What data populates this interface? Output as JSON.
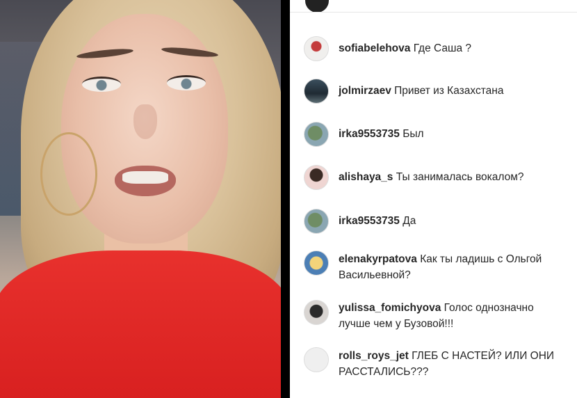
{
  "comments": [
    {
      "username": "sofiabelehova",
      "message": "Где Саша ?",
      "avatar": "profile-photo"
    },
    {
      "username": "jolmirzaev",
      "message": "Привет из Казахстана",
      "avatar": "profile-photo"
    },
    {
      "username": "irka9553735",
      "message": "Был",
      "avatar": "profile-photo"
    },
    {
      "username": "alishaya_s",
      "message": "Ты занималась вокалом?",
      "avatar": "profile-photo"
    },
    {
      "username": "irka9553735",
      "message": "Да",
      "avatar": "profile-photo"
    },
    {
      "username": "elenakyrpatova",
      "message": "Как ты ладишь с Ольгой Васильевной?",
      "avatar": "profile-photo"
    },
    {
      "username": "yulissa_fomichyova",
      "message": "Голос однозначно лучше чем у Бузовой!!!",
      "avatar": "profile-photo"
    },
    {
      "username": "rolls_roys_jet",
      "message": "ГЛЕБ С НАСТЕЙ? ИЛИ ОНИ РАССТАЛИСЬ???",
      "avatar": "default-avatar"
    }
  ]
}
